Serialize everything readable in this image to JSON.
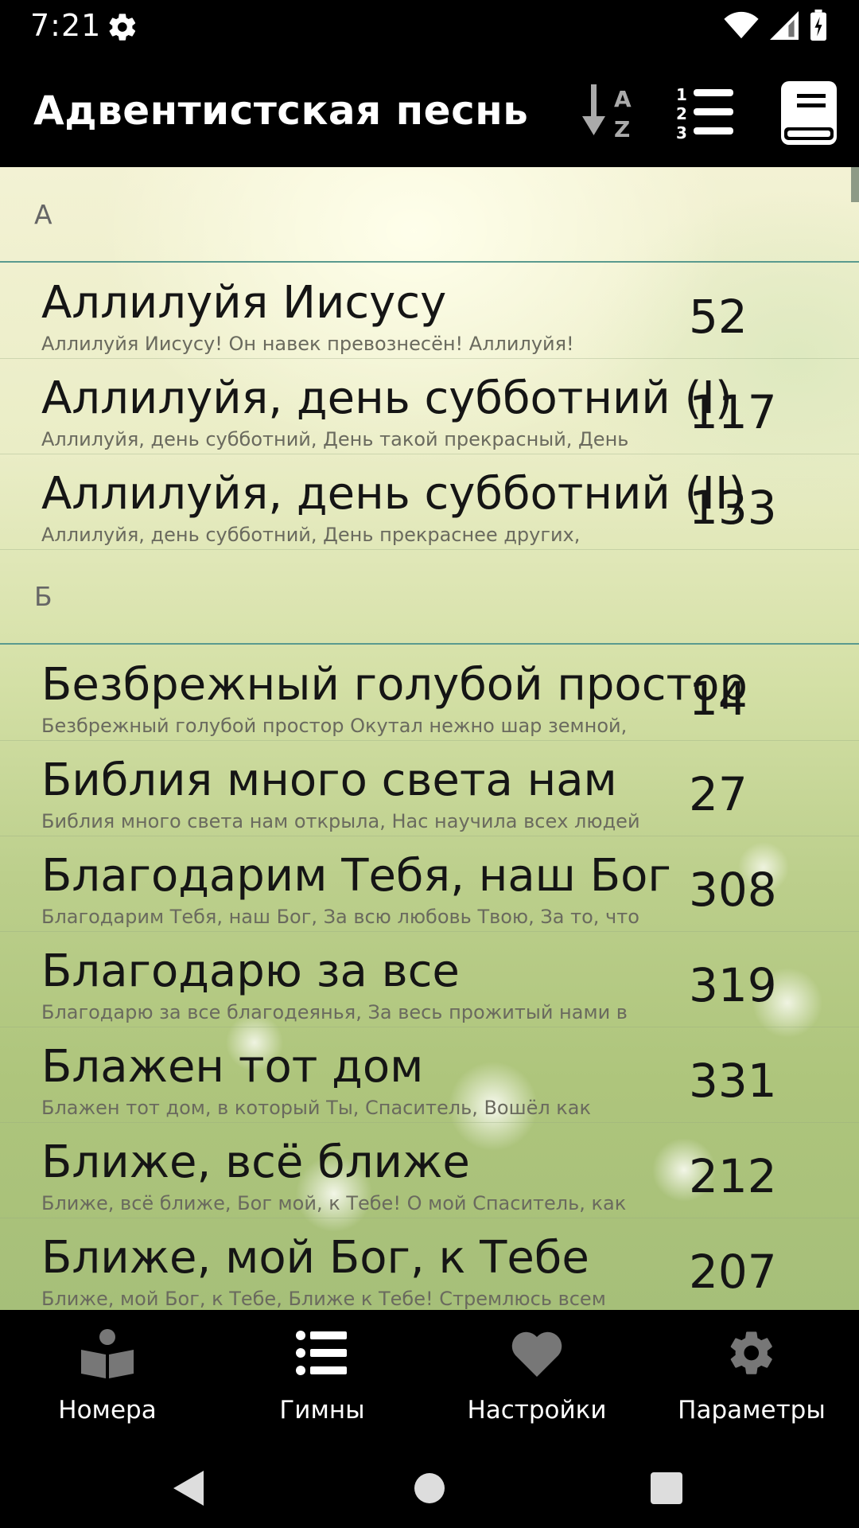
{
  "status_bar": {
    "time": "7:21"
  },
  "app_bar": {
    "title": "Адвентистская песнь",
    "sort_alpha_icon": "sort-alpha-icon",
    "sort_number_icon": "sort-number-icon",
    "book_icon": "book-icon"
  },
  "sections": [
    {
      "letter": "А",
      "hymns": [
        {
          "title": "Аллилуйя Иисусу",
          "subtitle": "Аллилуйя Иисусу! Он навек превознесён! Аллилуйя!",
          "number": "52"
        },
        {
          "title": "Аллилуйя, день субботний (I)",
          "subtitle": "Аллилуйя, день субботний, День такой прекрасный, День",
          "number": "117"
        },
        {
          "title": "Аллилуйя, день субботний (II)",
          "subtitle": "Аллилуйя, день субботний, День прекраснее других,",
          "number": "133"
        }
      ]
    },
    {
      "letter": "Б",
      "hymns": [
        {
          "title": "Безбрежный голубой простор",
          "subtitle": "Безбрежный голубой простор Окутал нежно шар земной,",
          "number": "14"
        },
        {
          "title": "Библия много света нам",
          "subtitle": "Библия много света нам открыла, Нас научила всех людей",
          "number": "27"
        },
        {
          "title": "Благодарим Тебя, наш Бог",
          "subtitle": "Благодарим Тебя, наш Бог, За всю любовь Твою, За то, что",
          "number": "308"
        },
        {
          "title": "Благодарю за все",
          "subtitle": "Благодарю за все благодеянья, За весь прожитый нами в",
          "number": "319"
        },
        {
          "title": "Блажен тот дом",
          "subtitle": "Блажен тот дом, в который Ты, Спаситель, Вошёл как",
          "number": "331"
        },
        {
          "title": "Ближе, всё ближе",
          "subtitle": "Ближе, всё ближе, Бог мой, к Тебе! О мой Спаситель, как",
          "number": "212"
        },
        {
          "title": "Ближе, мой Бог, к Тебе",
          "subtitle": "Ближе, мой Бог, к Тебе, Ближе к Тебе! Стремлюсь всем",
          "number": "207"
        }
      ]
    }
  ],
  "bottom_nav": [
    {
      "label": "Номера",
      "icon": "open-book-icon",
      "active": false
    },
    {
      "label": "Гимны",
      "icon": "list-icon",
      "active": true
    },
    {
      "label": "Настройки",
      "icon": "heart-icon",
      "active": false
    },
    {
      "label": "Параметры",
      "icon": "gear-icon",
      "active": false
    }
  ],
  "colors": {
    "accent_divider": "#5a9a8f",
    "inactive_icon": "#777777"
  }
}
